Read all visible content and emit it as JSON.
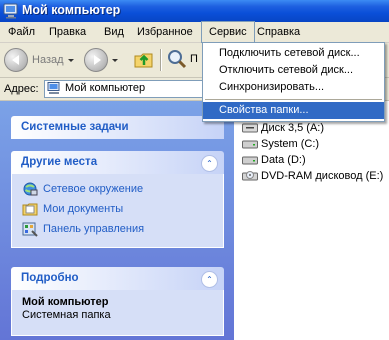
{
  "window": {
    "title": "Мой компьютер"
  },
  "menubar": {
    "items": [
      {
        "label": "Файл"
      },
      {
        "label": "Правка"
      },
      {
        "label": "Вид"
      },
      {
        "label": "Избранное"
      },
      {
        "label": "Сервис"
      },
      {
        "label": "Справка"
      }
    ]
  },
  "toolbar": {
    "back_label": "Назад",
    "forward_label": "",
    "search_label": "П"
  },
  "address": {
    "label": "Адрес:",
    "value": "Мой компьютер"
  },
  "service_menu": {
    "items": [
      {
        "label": "Подключить сетевой диск..."
      },
      {
        "label": "Отключить сетевой диск..."
      },
      {
        "label": "Синхронизировать..."
      },
      {
        "label": "Свойства папки..."
      }
    ],
    "selected_index": 3
  },
  "left_pane": {
    "system_tasks": {
      "title": "Системные задачи"
    },
    "other_places": {
      "title": "Другие места",
      "links": [
        {
          "label": "Сетевое окружение",
          "icon": "network-icon"
        },
        {
          "label": "Мои документы",
          "icon": "documents-icon"
        },
        {
          "label": "Панель управления",
          "icon": "control-panel-icon"
        }
      ]
    },
    "details": {
      "title": "Подробно",
      "name": "Мой компьютер",
      "description": "Системная папка"
    }
  },
  "drives": [
    {
      "label": "Диск 3,5 (A:)",
      "icon": "floppy-drive-icon"
    },
    {
      "label": "System (C:)",
      "icon": "hard-drive-icon"
    },
    {
      "label": "Data (D:)",
      "icon": "hard-drive-icon"
    },
    {
      "label": "DVD-RAM дисковод (E:)",
      "icon": "dvd-drive-icon"
    }
  ],
  "colors": {
    "title_bar": "#0a4fd8",
    "menu_highlight": "#316ac5",
    "task_pane_bg": "#6375d6",
    "link_text": "#215dc6"
  }
}
